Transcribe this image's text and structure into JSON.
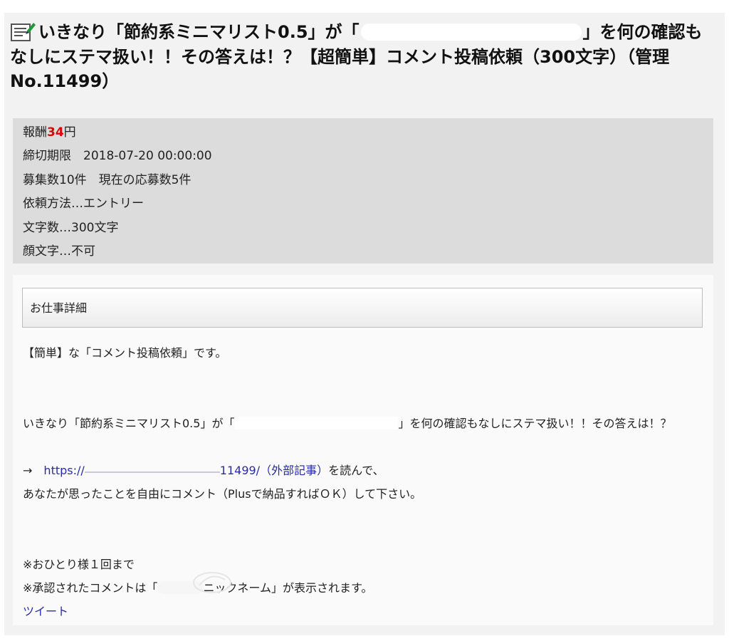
{
  "title": {
    "part1": "いきなり「節約系ミニマリスト0.5」が「",
    "part2": "」を何の確認もなしにステマ扱い！！その答えは！？【超簡単】コメント投稿依頼（300文字）（管理No.11499）"
  },
  "info": {
    "reward_label": "報酬",
    "reward_value": "34",
    "reward_unit": "円",
    "deadline": "締切期限　2018-07-20 00:00:00",
    "recruit": "募集数10件　現在の応募数5件",
    "method": "依頼方法…エントリー",
    "char_count": "文字数…300文字",
    "emoticon": "顔文字…不可"
  },
  "details": {
    "header": "お仕事詳細",
    "intro": "【簡単】な「コメント投稿依頼」です。",
    "para1_a": "いきなり「節約系ミニマリスト0.5」が「",
    "para1_b": "」を何の確認もなしにステマ扱い！！その答えは！？",
    "arrow": "→　",
    "link_start": "https://",
    "link_end": "11499/（外部記事）",
    "link_suffix": "を読んで、",
    "instruction": "あなたが思ったことを自由にコメント（Plusで納品すればＯＫ）して下さい。",
    "note1": "※おひとり様１回まで",
    "note2_a": "※承認されたコメントは「",
    "note2_b": "ニックネーム」が表示されます。",
    "tweet": "ツイート"
  },
  "colors": {
    "price": "#e00000",
    "link": "#2a2aa8",
    "info_bg": "#dcdcdc",
    "page_bg": "#f2f2f2"
  },
  "icons": {
    "title": "memo-pencil-icon"
  }
}
